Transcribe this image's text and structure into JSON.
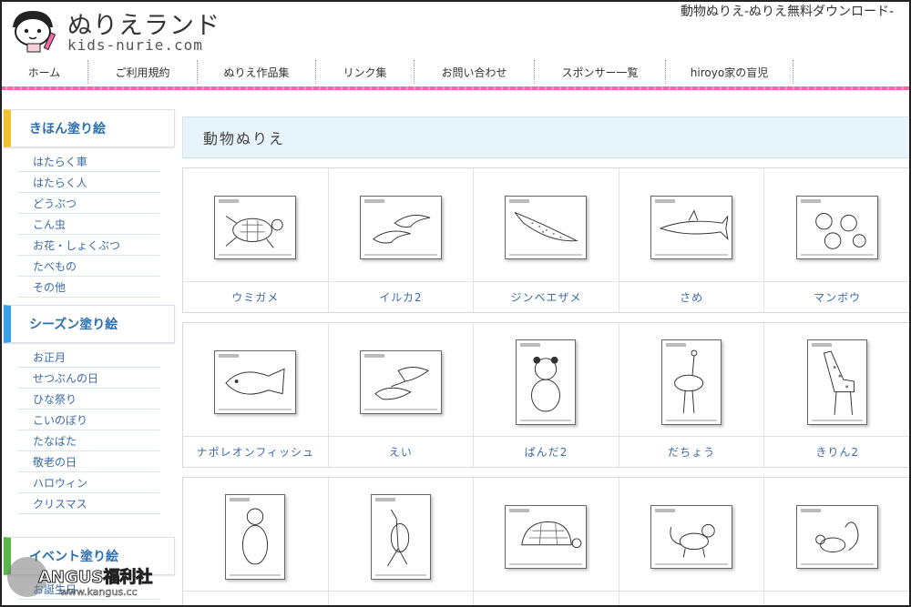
{
  "header": {
    "site_title": "ぬりえランド",
    "site_url": "kids-nurie.com",
    "page_heading": "動物ぬりえ-ぬりえ無料ダウンロード-"
  },
  "nav": [
    "ホーム",
    "ご利用規約",
    "ぬりえ作品集",
    "リンク集",
    "お問い合わせ",
    "スポンサー一覧",
    "hiroyo家の盲児"
  ],
  "sidebar": {
    "basic": {
      "title": "きほん塗り絵",
      "items": [
        "はたらく車",
        "はたらく人",
        "どうぶつ",
        "こん虫",
        "お花・しょくぶつ",
        "たべもの",
        "その他"
      ]
    },
    "season": {
      "title": "シーズン塗り絵",
      "items": [
        "お正月",
        "せつぶんの日",
        "ひな祭り",
        "こいのぼり",
        "たなばた",
        "敬老の日",
        "ハロウィン",
        "クリスマス"
      ]
    },
    "event": {
      "title": "イベント塗り絵",
      "items": [
        "お誕生日"
      ]
    }
  },
  "main": {
    "title": "動物ぬりえ",
    "rows": [
      [
        {
          "label": "ウミガメ",
          "icon": "sea-turtle"
        },
        {
          "label": "イルカ2",
          "icon": "dolphins"
        },
        {
          "label": "ジンベエザメ",
          "icon": "whale-shark"
        },
        {
          "label": "さめ",
          "icon": "shark"
        },
        {
          "label": "マンボウ",
          "icon": "sunfish"
        }
      ],
      [
        {
          "label": "ナポレオンフィッシュ",
          "icon": "napoleon-fish"
        },
        {
          "label": "えい",
          "icon": "manta-ray"
        },
        {
          "label": "ぱんだ2",
          "icon": "panda"
        },
        {
          "label": "だちょう",
          "icon": "ostrich"
        },
        {
          "label": "きりん2",
          "icon": "giraffe"
        }
      ],
      [
        {
          "label": "",
          "icon": "bear"
        },
        {
          "label": "",
          "icon": "kangaroo"
        },
        {
          "label": "",
          "icon": "tortoise"
        },
        {
          "label": "",
          "icon": "monkey"
        },
        {
          "label": "",
          "icon": "squirrel"
        }
      ]
    ]
  },
  "watermark": {
    "text": "ANGUS福利社",
    "url": "www.kangus.cc"
  }
}
